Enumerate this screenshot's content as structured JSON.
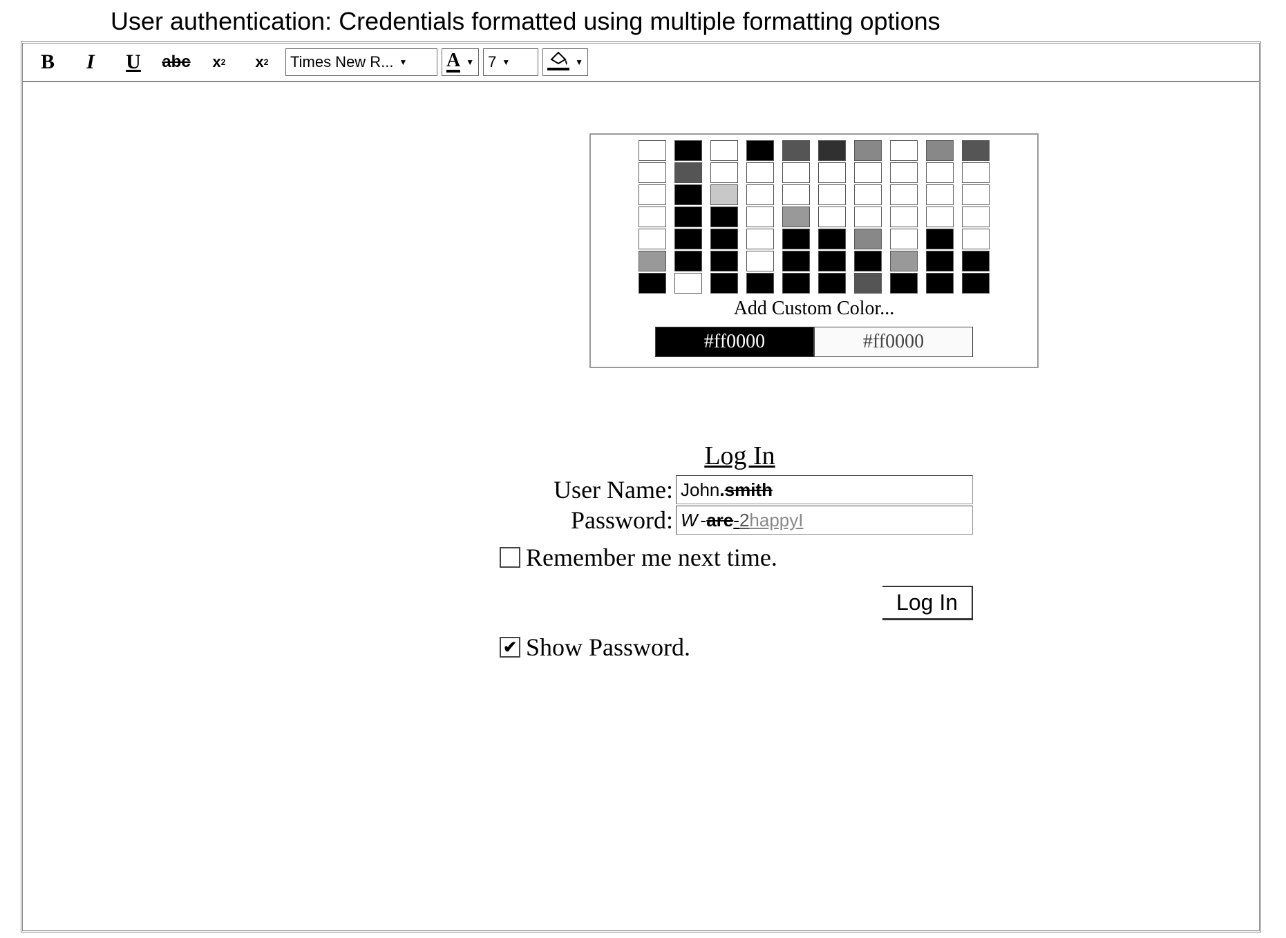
{
  "title": "User authentication: Credentials formatted using multiple formatting options",
  "toolbar": {
    "bold_glyph": "B",
    "italic_glyph": "I",
    "underline_glyph": "U",
    "strike_glyph": "abc",
    "sup_glyph": "x",
    "sup_exp": "2",
    "sub_glyph": "x",
    "sub_exp": "2",
    "font_name": "Times New R...",
    "font_color_letter": "A",
    "font_size": "7"
  },
  "color_picker": {
    "columns": [
      [
        "#ffffff",
        "#ffffff",
        "#ffffff",
        "#ffffff",
        "#ffffff",
        "#999999",
        "#000000"
      ],
      [
        "#000000",
        "#555555",
        "#000000",
        "#000000",
        "#000000",
        "#000000",
        "#ffffff"
      ],
      [
        "#ffffff",
        "#ffffff",
        "#c8c8c8",
        "#000000",
        "#000000",
        "#000000",
        "#000000"
      ],
      [
        "#000000",
        "#ffffff",
        "#ffffff",
        "#ffffff",
        "#ffffff",
        "#ffffff",
        "#000000"
      ],
      [
        "#555555",
        "#ffffff",
        "#ffffff",
        "#999999",
        "#000000",
        "#000000",
        "#000000"
      ],
      [
        "#303030",
        "#ffffff",
        "#ffffff",
        "#ffffff",
        "#000000",
        "#000000",
        "#000000"
      ],
      [
        "#888888",
        "#ffffff",
        "#ffffff",
        "#ffffff",
        "#888888",
        "#000000",
        "#555555"
      ],
      [
        "#ffffff",
        "#ffffff",
        "#ffffff",
        "#ffffff",
        "#ffffff",
        "#999999",
        "#000000"
      ],
      [
        "#888888",
        "#ffffff",
        "#ffffff",
        "#ffffff",
        "#000000",
        "#000000",
        "#000000"
      ],
      [
        "#555555",
        "#ffffff",
        "#ffffff",
        "#ffffff",
        "#ffffff",
        "#000000",
        "#000000"
      ]
    ],
    "add_custom_label": "Add Custom Color...",
    "hex_dark": "#ff0000",
    "hex_light": "#ff0000"
  },
  "login": {
    "heading": "Log In",
    "username_label": "User Name:",
    "password_label": "Password:",
    "username": {
      "p1": "John",
      "p2": ".",
      "p3": "smith"
    },
    "password": {
      "p1": "W",
      "p2": " -",
      "p3": "are",
      "p4": "-",
      "p5": "2",
      "p6": "happyI"
    },
    "remember_label": "Remember me next time.",
    "show_password_label": "Show Password.",
    "submit_label": "Log In",
    "remember_checked": false,
    "show_password_checked": true
  }
}
